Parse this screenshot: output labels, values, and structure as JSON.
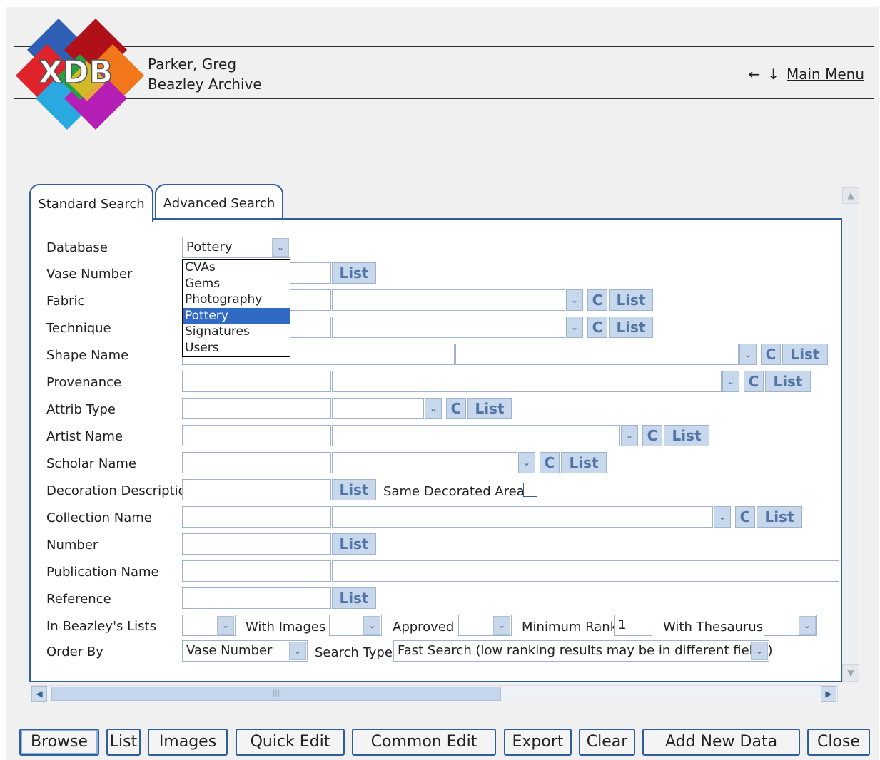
{
  "header": {
    "logo_text": "XDB",
    "user_name": "Parker, Greg",
    "archive_name": "Beazley Archive",
    "back_arrow": "←",
    "down_arrow": "↓",
    "main_menu": "Main Menu"
  },
  "tabs": [
    {
      "label": "Standard Search",
      "active": true
    },
    {
      "label": "Advanced Search",
      "active": false
    }
  ],
  "form": {
    "list_label": "List",
    "clear_label": "C",
    "dropdown_glyph": "⌄",
    "labels": {
      "database": "Database",
      "vase_number": "Vase Number",
      "fabric": "Fabric",
      "technique": "Technique",
      "shape_name": "Shape Name",
      "provenance": "Provenance",
      "attrib_type": "Attrib Type",
      "artist_name": "Artist Name",
      "scholar_name": "Scholar Name",
      "decoration_description": "Decoration Description",
      "collection_name": "Collection Name",
      "number": "Number",
      "publication_name": "Publication Name",
      "reference": "Reference",
      "in_beazleys_lists": "In Beazley's Lists",
      "order_by": "Order By"
    },
    "database_value": "Pottery",
    "database_options": [
      "CVAs",
      "Gems",
      "Photography",
      "Pottery",
      "Signatures",
      "Users"
    ],
    "database_selected": "Pottery",
    "same_decorated_area": "Same Decorated Area",
    "with_images": "With Images",
    "approved": "Approved",
    "minimum_rank": "Minimum Rank",
    "minimum_rank_value": "1",
    "with_thesaurus": "With Thesaurus",
    "order_by_value": "Vase Number",
    "search_type": "Search Type",
    "search_type_value": "Fast Search (low ranking results may be in different fields)"
  },
  "buttons": {
    "browse": "Browse",
    "list": "List",
    "images": "Images",
    "quick_edit": "Quick Edit",
    "common_edit": "Common Edit",
    "export": "Export",
    "clear": "Clear",
    "add_new_data": "Add New Data",
    "close": "Close"
  },
  "colors": {
    "accent": "#2d5fa0",
    "button_fill": "#c7d7ec",
    "selection": "#316ac5"
  }
}
